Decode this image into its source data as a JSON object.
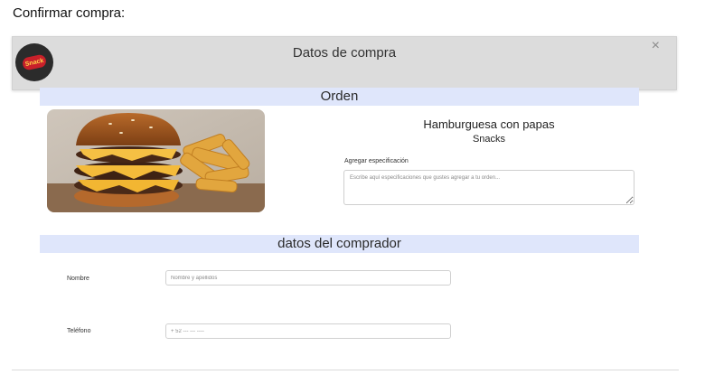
{
  "page": {
    "heading": "Confirmar compra:"
  },
  "modal": {
    "title": "Datos de compra",
    "close_symbol": "×",
    "logo_icon": "restaurant-logo",
    "logo_text": "Snack"
  },
  "order": {
    "section_title": "Orden",
    "image_icon": "hamburger-with-fries-photo",
    "product_name": "Hamburguesa con papas",
    "product_category": "Snacks",
    "spec_label": "Agregar especificación",
    "spec_placeholder": "Escribe aquí especificaciones que gustes agregar a tu orden...",
    "spec_value": ""
  },
  "buyer": {
    "section_title": "datos del comprador",
    "name_label": "Nombre",
    "name_placeholder": "Nombre y apellidos",
    "name_value": "",
    "phone_label": "Teléfono",
    "phone_placeholder": "+ 52 --- --- ----",
    "phone_value": ""
  },
  "colors": {
    "header_bg": "#dcdcdc",
    "section_bar_bg": "#dfe6fb",
    "logo_bg": "#2b2b2b",
    "logo_accent": "#c8202a"
  }
}
